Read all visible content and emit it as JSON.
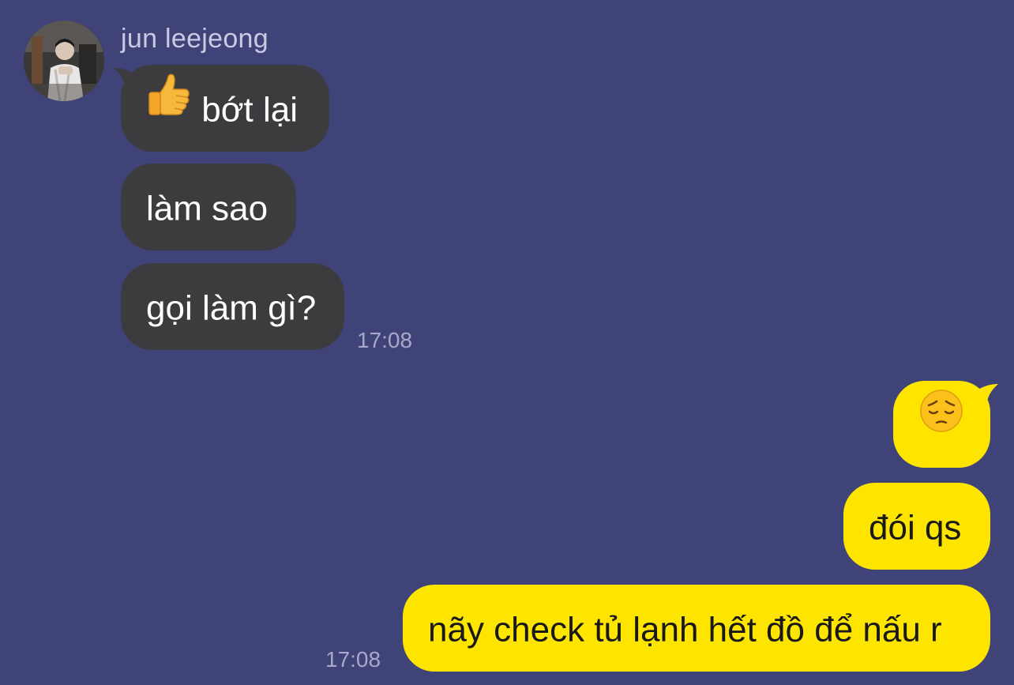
{
  "contact": {
    "name": "jun leejeong"
  },
  "incoming": [
    {
      "emoji": "thumbs-up-icon",
      "text": "bớt lại"
    },
    {
      "text": "làm sao"
    },
    {
      "text": "gọi làm gì?"
    }
  ],
  "incoming_time": "17:08",
  "outgoing": [
    {
      "emoji": "pensive-face-icon",
      "text": ""
    },
    {
      "text": "đói qs"
    },
    {
      "text": "nãy check tủ lạnh hết đồ để nấu r"
    }
  ],
  "outgoing_time": "17:08",
  "colors": {
    "background": "#404377",
    "incoming_bubble": "#3c3c3f",
    "outgoing_bubble": "#fee500",
    "timestamp": "#a7a9cb"
  }
}
